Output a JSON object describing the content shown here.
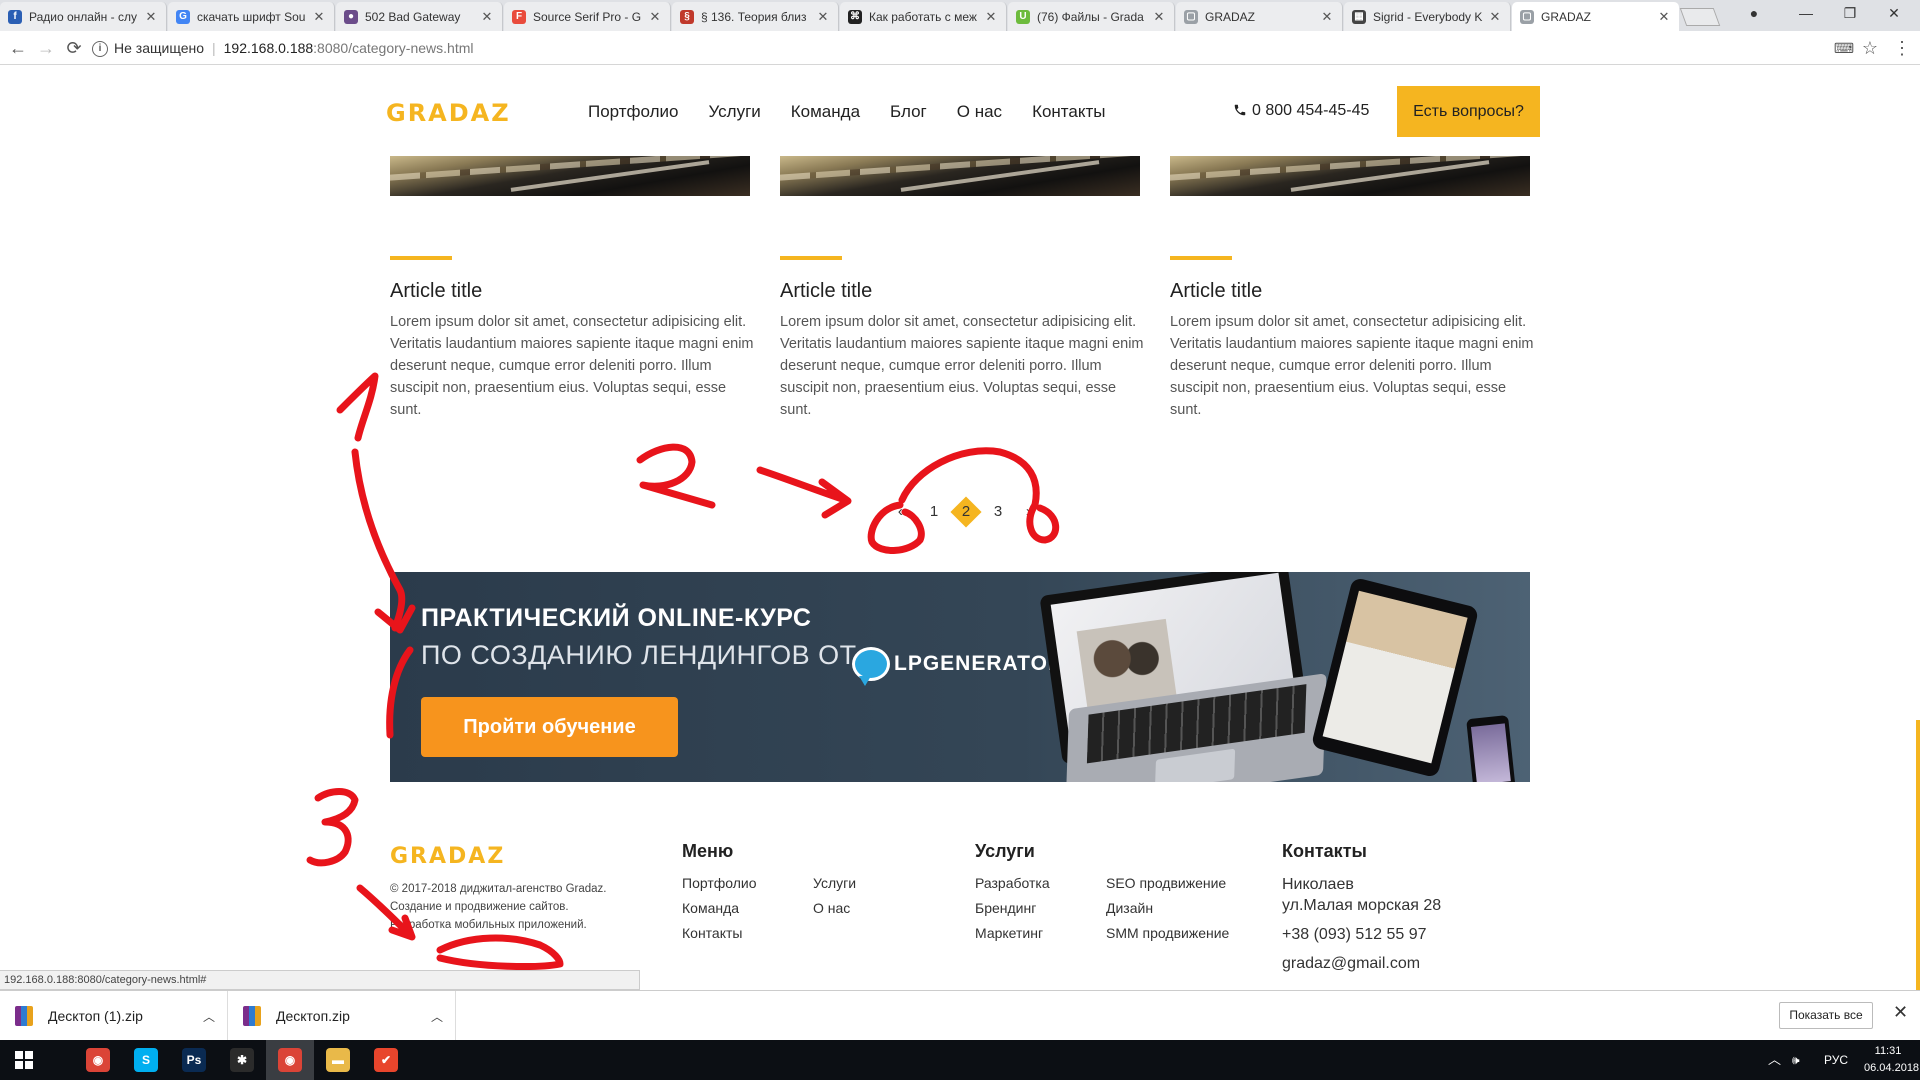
{
  "tabs": [
    {
      "title": "Радио онлайн - слу",
      "favicon_color": "#2b5fb4",
      "glyph": "f"
    },
    {
      "title": "скачать шрифт Sou",
      "favicon_color": "#4285f4",
      "glyph": "G"
    },
    {
      "title": "502 Bad Gateway",
      "favicon_color": "#6b4c8a",
      "glyph": "●"
    },
    {
      "title": "Source Serif Pro - G",
      "favicon_color": "#e94b3c",
      "glyph": "F"
    },
    {
      "title": "§ 136. Теория близ",
      "favicon_color": "#c0392b",
      "glyph": "§"
    },
    {
      "title": "Как работать с меж",
      "favicon_color": "#222222",
      "glyph": "⌘"
    },
    {
      "title": "(76) Файлы - Grada",
      "favicon_color": "#6dbb3d",
      "glyph": "U"
    },
    {
      "title": "GRADAZ",
      "favicon_color": "#9aa0a6",
      "glyph": "▢"
    },
    {
      "title": "Sigrid - Everybody K",
      "favicon_color": "#444444",
      "glyph": "▦"
    },
    {
      "title": "GRADAZ",
      "favicon_color": "#9aa0a6",
      "glyph": "▢",
      "active": true
    }
  ],
  "address": {
    "security": "Не защищено",
    "host": "192.168.0.188",
    "path": ":8080/category-news.html"
  },
  "site": {
    "logo": "GRADAZ",
    "menu": [
      "Портфолио",
      "Услуги",
      "Команда",
      "Блог",
      "О нас",
      "Контакты"
    ],
    "phone": "0 800 454-45-45",
    "cta": "Есть вопросы?"
  },
  "articles": [
    {
      "title": "Article title",
      "text": "Lorem ipsum dolor sit amet, consectetur adipisicing elit. Veritatis laudantium maiores sapiente itaque magni enim deserunt neque, cumque error deleniti porro. Illum suscipit non, praesentium eius. Voluptas sequi, esse sunt."
    },
    {
      "title": "Article title",
      "text": "Lorem ipsum dolor sit amet, consectetur adipisicing elit. Veritatis laudantium maiores sapiente itaque magni enim deserunt neque, cumque error deleniti porro. Illum suscipit non, praesentium eius. Voluptas sequi, esse sunt."
    },
    {
      "title": "Article title",
      "text": "Lorem ipsum dolor sit amet, consectetur adipisicing elit. Veritatis laudantium maiores sapiente itaque magni enim deserunt neque, cumque error deleniti porro. Illum suscipit non, praesentium eius. Voluptas sequi, esse sunt."
    }
  ],
  "pagination": {
    "prev": "«",
    "pages": [
      "1",
      "2",
      "3"
    ],
    "current": "2",
    "next": "»"
  },
  "banner": {
    "line1": "ПРАКТИЧЕСКИЙ ONLINE-КУРС",
    "line2": "ПО СОЗДАНИЮ ЛЕНДИНГОВ ОТ",
    "brand": "LPGENERATOR",
    "button": "Пройти обучение"
  },
  "footer": {
    "logo": "GRADAZ",
    "copyright": [
      "© 2017-2018 диджитал-агенство Gradaz.",
      "Создание и продвижение сайтов.",
      "Разработка мобильных приложений."
    ],
    "menu_title": "Меню",
    "menu": [
      "Портфолио",
      "Услуги",
      "Команда",
      "О нас",
      "Контакты"
    ],
    "services_title": "Услуги",
    "services": [
      "Разработка",
      "SEO продвижение",
      "Брендинг",
      "Дизайн",
      "Маркетинг",
      "SMM продвижение"
    ],
    "contacts_title": "Контакты",
    "city": "Николаев",
    "street": "ул.Малая морская 28",
    "phone": "+38 (093) 512 55 97",
    "email": "gradaz@gmail.com"
  },
  "status_url": "192.168.0.188:8080/category-news.html#",
  "annotations": {
    "color": "#e8141b",
    "labels": [
      "1",
      "2",
      "3"
    ]
  },
  "downloads": {
    "items": [
      "Десктоп (1).zip",
      "Десктоп.zip"
    ],
    "show_all": "Показать все"
  },
  "taskbar": {
    "apps": [
      {
        "name": "chrome",
        "color": "#db4437",
        "glyph": "◉"
      },
      {
        "name": "skype",
        "color": "#00aff0",
        "glyph": "S"
      },
      {
        "name": "photoshop",
        "color": "#0a2a52",
        "glyph": "Ps"
      },
      {
        "name": "slack",
        "color": "#2b2b2b",
        "glyph": "✱"
      },
      {
        "name": "chrome-active",
        "color": "#db4437",
        "glyph": "◉",
        "active": true
      },
      {
        "name": "explorer",
        "color": "#e9b949",
        "glyph": "▬"
      },
      {
        "name": "tasks",
        "color": "#e8452c",
        "glyph": "✔"
      }
    ],
    "language": "РУС",
    "time": "11:31",
    "date": "06.04.2018"
  }
}
